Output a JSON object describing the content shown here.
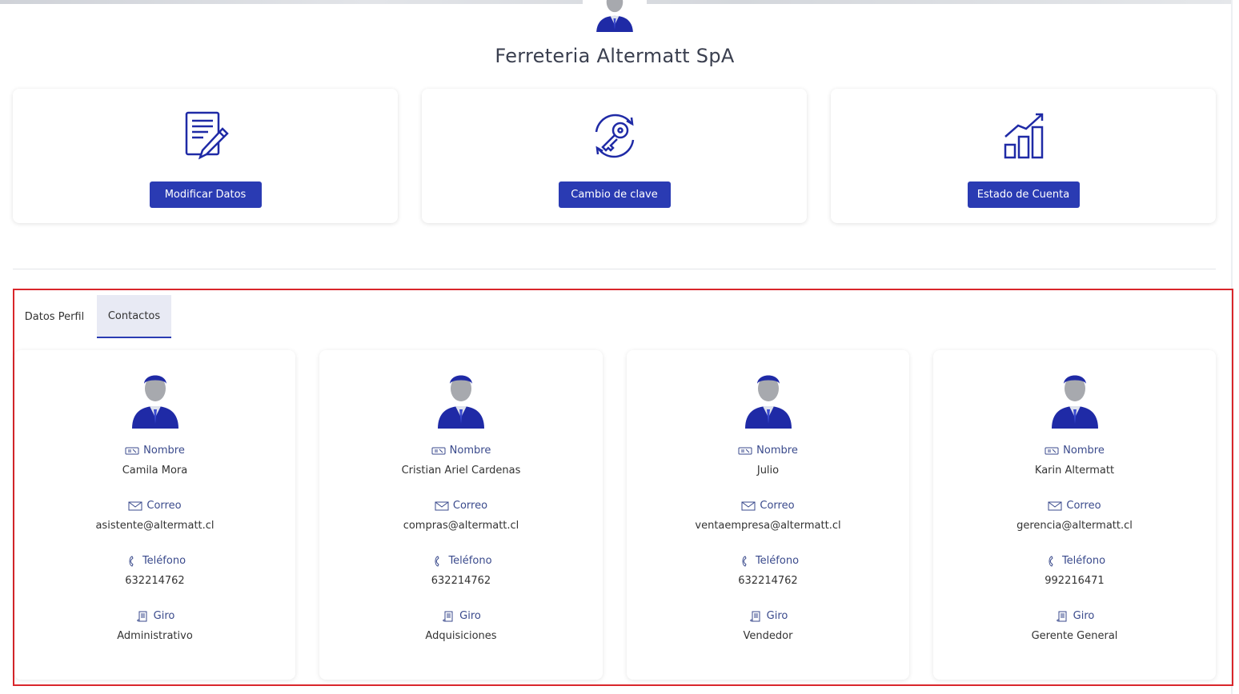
{
  "company": {
    "name": "Ferreteria Altermatt SpA"
  },
  "actions": [
    {
      "label": "Modificar Datos",
      "icon": "edit-document-icon"
    },
    {
      "label": "Cambio de clave",
      "icon": "key-refresh-icon"
    },
    {
      "label": "Estado de Cuenta",
      "icon": "growth-chart-icon"
    }
  ],
  "tabs": [
    {
      "label": "Datos Perfil",
      "active": false
    },
    {
      "label": "Contactos",
      "active": true
    }
  ],
  "field_labels": {
    "name": "Nombre",
    "email": "Correo",
    "phone": "Teléfono",
    "role": "Giro"
  },
  "contacts": [
    {
      "name": "Camila Mora",
      "email": "asistente@altermatt.cl",
      "phone": "632214762",
      "role": "Administrativo"
    },
    {
      "name": "Cristian Ariel Cardenas",
      "email": "compras@altermatt.cl",
      "phone": "632214762",
      "role": "Adquisiciones"
    },
    {
      "name": "Julio",
      "email": "ventaempresa@altermatt.cl",
      "phone": "632214762",
      "role": "Vendedor"
    },
    {
      "name": "Karin Altermatt",
      "email": "gerencia@altermatt.cl",
      "phone": "992216471",
      "role": "Gerente General"
    }
  ],
  "colors": {
    "primary": "#2a3bb3",
    "highlight_border": "#d9262b",
    "label": "#3a4a8c"
  }
}
